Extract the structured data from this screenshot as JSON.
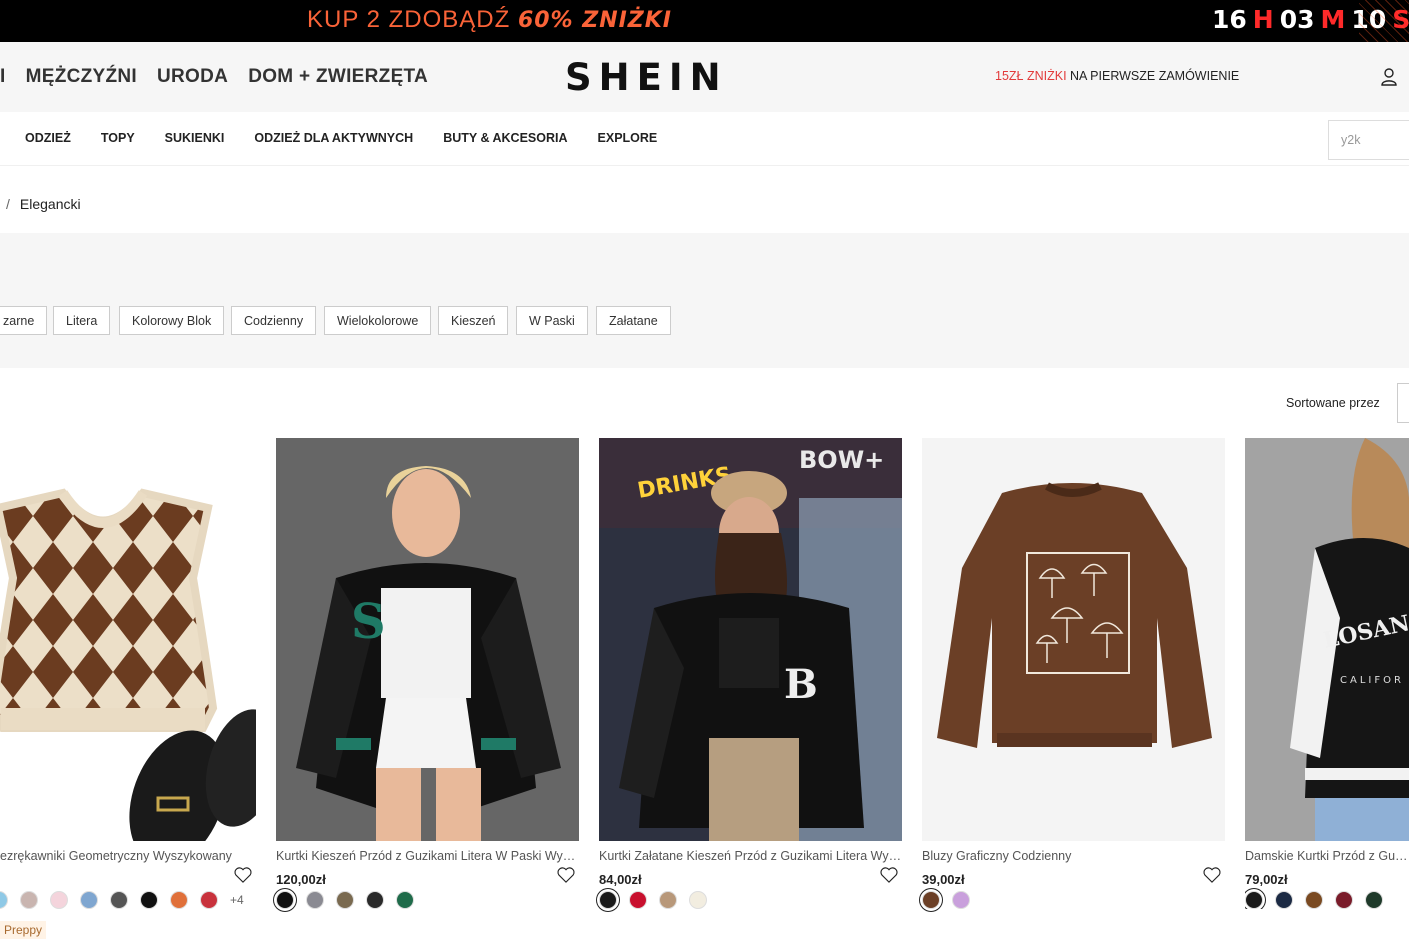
{
  "promo_bar": {
    "text": "KUP 2 ZDOBĄDŹ",
    "highlight": "60% ZNIŻKI",
    "countdown": {
      "hours": "16",
      "h": "H",
      "minutes": "03",
      "m": "M",
      "seconds": "10",
      "s": "S"
    }
  },
  "header": {
    "nav": [
      "I",
      "MĘŻCZYŹNI",
      "URODA",
      "DOM + ZWIERZĘTA"
    ],
    "logo": "SHEIN",
    "promo_red": "15ZŁ ZNIŻKI",
    "promo_text": " NA PIERWSZE ZAMÓWIENIE"
  },
  "catnav": {
    "items": [
      "ODZIEŻ",
      "TOPY",
      "SUKIENKI",
      "ODZIEŻ DLA AKTYWNYCH",
      "BUTY & AKCESORIA",
      "EXPLORE"
    ],
    "search_value": "y2k"
  },
  "breadcrumb": {
    "sep": "/",
    "current": "Elegancki"
  },
  "filters": [
    "zarne",
    "Litera",
    "Kolorowy Blok",
    "Codzienny",
    "Wielokolorowe",
    "Kieszeń",
    "W Paski",
    "Załatane"
  ],
  "sort": {
    "label": "Sortowane przez"
  },
  "products": [
    {
      "title": "ezrękawniki Geometryczny Wyszykowany",
      "price": "",
      "more": "+4",
      "badge": "Preppy",
      "swatches": [
        "#8fc9e6",
        "#c9b5b0",
        "#f4d4dc",
        "#7fa6d0",
        "#555555",
        "#111111",
        "#e0703a",
        "#c8323c"
      ]
    },
    {
      "title": "Kurtki Kieszeń Przód z Guzikami Litera W Paski Wyszykowany",
      "price": "120,00zł",
      "swatches": [
        "#111111",
        "#8a8a92",
        "#7a6a50",
        "#2a2a2a",
        "#1f6b4a"
      ]
    },
    {
      "title": "Kurtki Załatane Kieszeń Przód z Guzikami Litera Wyszykowany",
      "price": "84,00zł",
      "swatches": [
        "#1a1a1a",
        "#c8102e",
        "#b8987a",
        "#f2ede0"
      ]
    },
    {
      "title": "Bluzy Graficzny Codzienny",
      "price": "39,00zł",
      "swatches": [
        "#6b3f26",
        "#c9a0dc"
      ]
    },
    {
      "title": "Damskie Kurtki Przód z Guzikami",
      "price": "79,00zł",
      "swatches": [
        "#1a1a1a",
        "#1c2a44",
        "#7a4a22",
        "#7a1c2a",
        "#1f3a2a"
      ]
    }
  ]
}
